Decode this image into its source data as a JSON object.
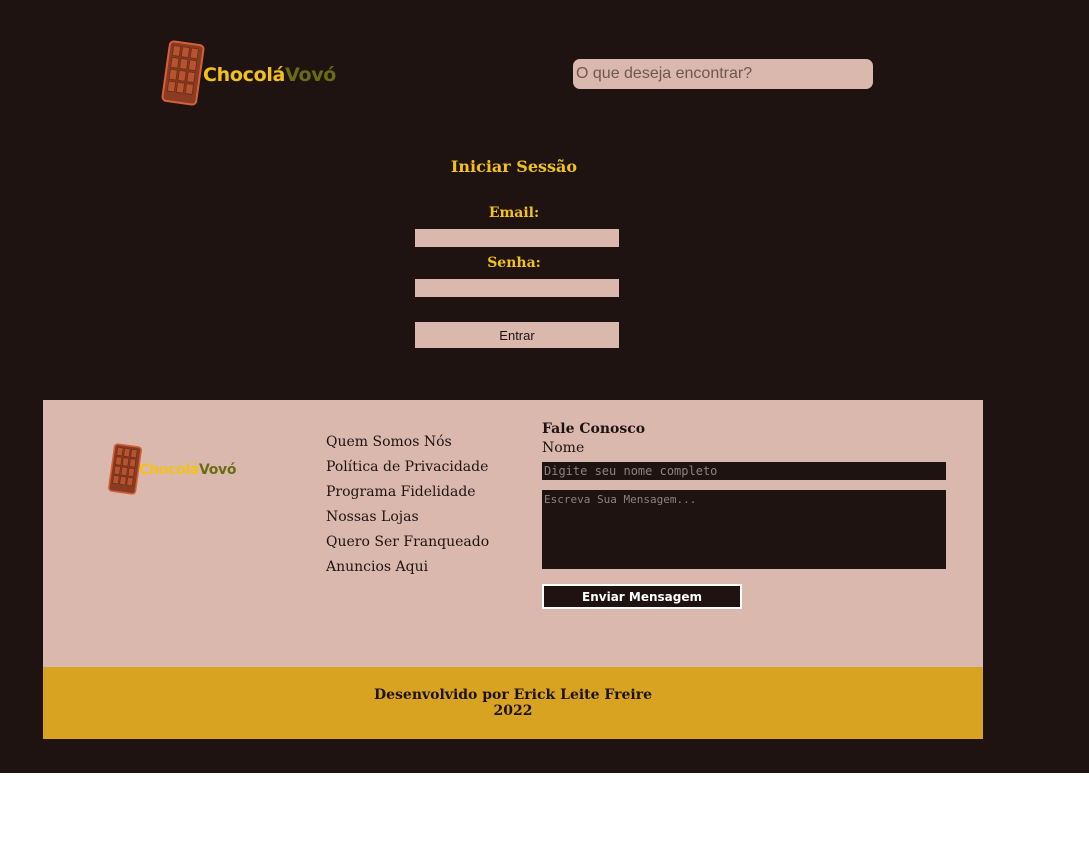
{
  "header": {
    "logo": {
      "part1": "Chocolá",
      "part2": "Vovó",
      "icon": "chocolate-bar-icon"
    },
    "search": {
      "placeholder": "O que deseja encontrar?"
    }
  },
  "login": {
    "title": "Iniciar Sessão",
    "email_label": "Email:",
    "password_label": "Senha:",
    "submit_label": "Entrar"
  },
  "footer": {
    "logo": {
      "part1": "Chocolá",
      "part2": "Vovó"
    },
    "links": [
      "Quem Somos Nós",
      "Política de Privacidade",
      "Programa Fidelidade",
      "Nossas Lojas",
      "Quero Ser Franqueado",
      "Anuncios Aqui"
    ],
    "contact": {
      "title": "Fale Conosco",
      "name_label": "Nome",
      "name_placeholder": "Digite seu nome completo",
      "message_placeholder": "Escreva Sua Mensagem...",
      "send_label": "Enviar Mensagem"
    },
    "credits": {
      "line1": "Desenvolvido por Erick Leite Freire",
      "line2": "2022"
    }
  },
  "colors": {
    "background": "#1e1311",
    "panel": "#dbb8ad",
    "accent_yellow": "#f2c21a",
    "accent_olive": "#6b6b16",
    "credits_band": "#d9a322"
  }
}
